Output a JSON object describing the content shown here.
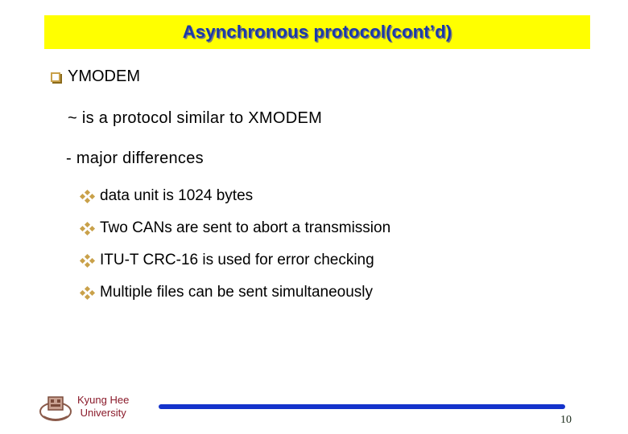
{
  "slide": {
    "title": "Asynchronous protocol(cont’d)",
    "heading": "YMODEM",
    "lines": [
      "~ is a protocol similar to XMODEM",
      "- major differences"
    ],
    "sub_items": [
      "data unit is 1024 bytes",
      "Two CANs are sent to abort a transmission",
      "ITU-T CRC-16 is used for error checking",
      "Multiple files can be sent simultaneously"
    ]
  },
  "footer": {
    "university_line1": "Kyung Hee",
    "university_line2": "University",
    "page_number": "10"
  },
  "colors": {
    "title_bg": "#ffff00",
    "title_text": "#1a3aa8",
    "bullet": "#c9a14a",
    "footer_rule": "#1433cc",
    "university": "#8a1a2a"
  }
}
